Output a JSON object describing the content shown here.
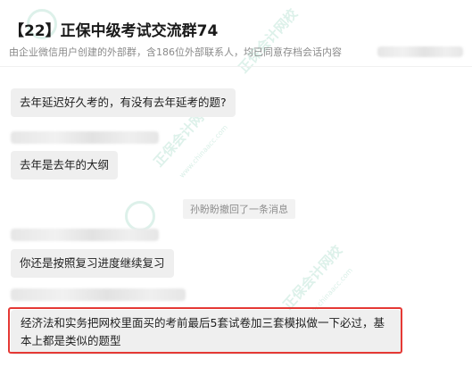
{
  "header": {
    "title": "【22】正保中级考试交流群74",
    "subtitle": "由企业微信用户创建的外部群，含186位外部联系人，均已同意存档会话内容"
  },
  "messages": [
    {
      "text": "去年延迟好久考的，有没有去年延考的题?"
    },
    {
      "text": "去年是去年的大纲"
    },
    {
      "text": "你还是按照复习进度继续复习"
    },
    {
      "text": "经济法和实务把网校里面买的考前最后5套试卷加三套模拟做一下必过，基本上都是类似的题型"
    }
  ],
  "system_message": "孙盼盼撤回了一条消息",
  "watermark": {
    "text": "正保会计网校",
    "url": "www.chinaacc.com",
    "color": "#66bea0"
  },
  "highlight_color": "#e53935"
}
